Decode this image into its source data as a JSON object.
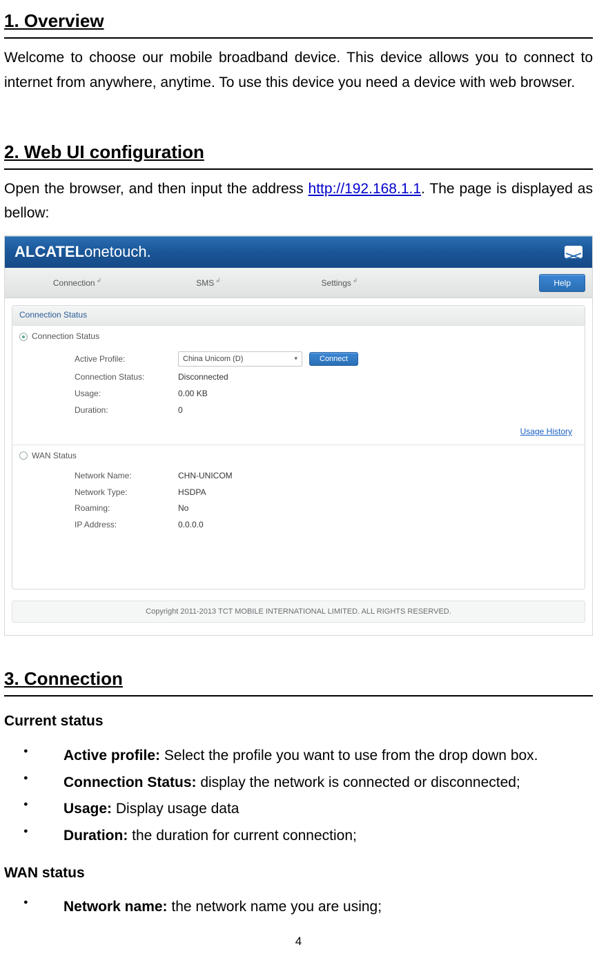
{
  "section1": {
    "heading": "1. Overview",
    "text": "Welcome to choose our mobile broadband device. This device allows you to connect to internet from anywhere, anytime. To use this device you need a device with web browser."
  },
  "section2": {
    "heading": "2. Web UI configuration",
    "text_before_link": "Open the browser, and then input the address ",
    "link_text": "http://192.168.1.1",
    "text_after_link": ". The page is displayed as bellow:"
  },
  "screenshot": {
    "brand1": "ALCATEL",
    "brand2": "onetouch.",
    "tabs": {
      "connection": "Connection",
      "sms": "SMS",
      "settings": "Settings",
      "mark": "↲"
    },
    "help": "Help",
    "panel_title": "Connection Status",
    "conn_section": {
      "title": "Connection Status",
      "active_profile_label": "Active Profile:",
      "active_profile_value": "China Unicom (D)",
      "connect": "Connect",
      "status_label": "Connection Status:",
      "status_value": "Disconnected",
      "usage_label": "Usage:",
      "usage_value": "0.00 KB",
      "duration_label": "Duration:",
      "duration_value": "0",
      "usage_history": "Usage History"
    },
    "wan_section": {
      "title": "WAN Status",
      "name_label": "Network Name:",
      "name_value": "CHN-UNICOM",
      "type_label": "Network Type:",
      "type_value": "HSDPA",
      "roaming_label": "Roaming:",
      "roaming_value": "No",
      "ip_label": "IP Address:",
      "ip_value": "0.0.0.0"
    },
    "copyright": "Copyright 2011-2013 TCT MOBILE INTERNATIONAL LIMITED. ALL RIGHTS RESERVED."
  },
  "section3": {
    "heading": "3. Connection",
    "current_status": "Current status",
    "bullets_current": [
      {
        "label": "Active profile:",
        "text": " Select the profile you want to use from the drop down box."
      },
      {
        "label": "Connection Status:",
        "text": " display the network is connected or disconnected;"
      },
      {
        "label": "Usage:",
        "text": " Display usage data"
      },
      {
        "label": "Duration:",
        "text": " the duration for current connection;"
      }
    ],
    "wan_status": "WAN status",
    "bullets_wan": [
      {
        "label": "Network name:",
        "text": " the network name you are using;"
      }
    ]
  },
  "page_number": "4"
}
